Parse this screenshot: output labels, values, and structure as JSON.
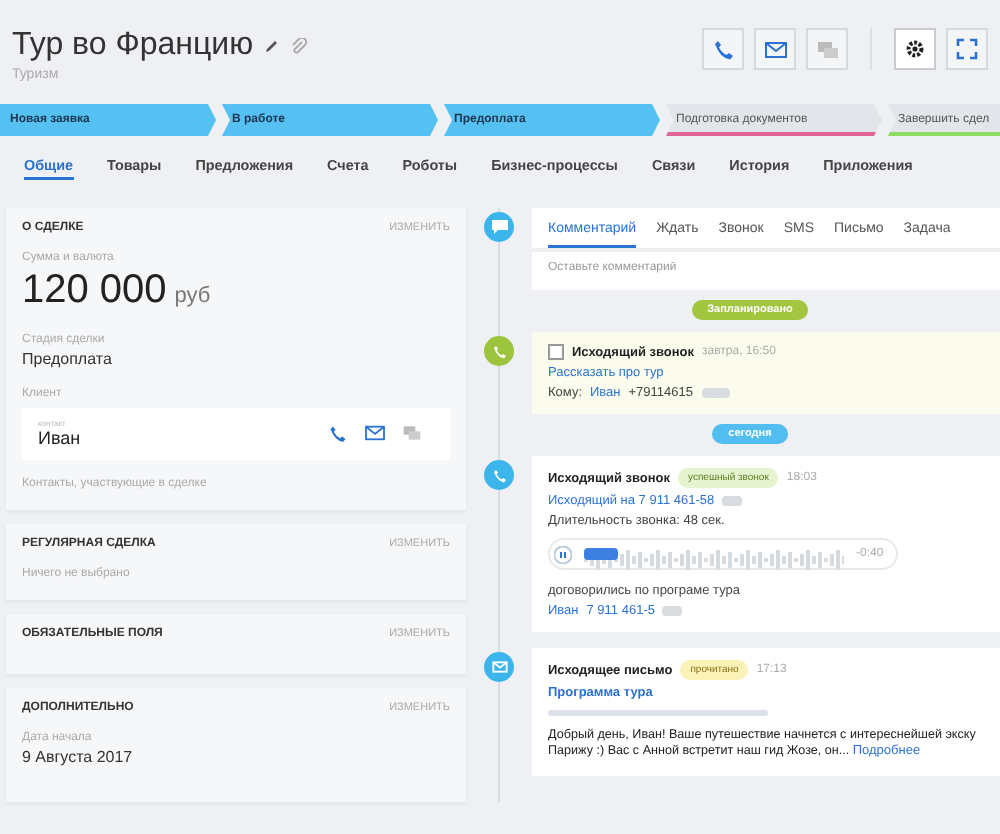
{
  "header": {
    "title": "Тур во Францию",
    "subtitle": "Туризм"
  },
  "stages": [
    {
      "label": "Новая заявка",
      "done": true,
      "color": "#55c0f2"
    },
    {
      "label": "В работе",
      "done": true,
      "color": "#55c0f2"
    },
    {
      "label": "Предоплата",
      "done": true,
      "color": "#55c0f2"
    },
    {
      "label": "Подготовка документов",
      "done": false,
      "color": "#e0669a"
    },
    {
      "label": "Завершить сдел",
      "done": false,
      "color": "#8fdb64"
    }
  ],
  "tabs": [
    {
      "label": "Общие",
      "selected": true
    },
    {
      "label": "Товары",
      "selected": false
    },
    {
      "label": "Предложения",
      "selected": false
    },
    {
      "label": "Счета",
      "selected": false
    },
    {
      "label": "Роботы",
      "selected": false
    },
    {
      "label": "Бизнес-процессы",
      "selected": false
    },
    {
      "label": "Связи",
      "selected": false
    },
    {
      "label": "История",
      "selected": false
    },
    {
      "label": "Приложения",
      "selected": false
    }
  ],
  "deal": {
    "title": "О СДЕЛКЕ",
    "edit": "ИЗМЕНИТЬ",
    "amount_label": "Сумма и валюта",
    "amount": "120 000",
    "currency": "руб",
    "stage_label": "Стадия сделки",
    "stage": "Предоплата",
    "client_label": "Клиент",
    "contact_label": "контакт",
    "contact": "Иван",
    "participants": "Контакты, участвующие в сделке"
  },
  "sections": [
    {
      "title": "РЕГУЛЯРНАЯ СДЕЛКА",
      "edit": "ИЗМЕНИТЬ",
      "note": "Ничего не выбрано"
    },
    {
      "title": "ОБЯЗАТЕЛЬНЫЕ ПОЛЯ",
      "edit": "ИЗМЕНИТЬ"
    },
    {
      "title": "ДОПОЛНИТЕЛЬНО",
      "edit": "ИЗМЕНИТЬ",
      "field_label": "Дата начала",
      "field_value": "9 Августа 2017"
    }
  ],
  "composer": {
    "tabs": [
      {
        "label": "Комментарий",
        "selected": true
      },
      {
        "label": "Ждать",
        "selected": false
      },
      {
        "label": "Звонок",
        "selected": false
      },
      {
        "label": "SMS",
        "selected": false
      },
      {
        "label": "Письмо",
        "selected": false
      },
      {
        "label": "Задача",
        "selected": false
      }
    ],
    "placeholder": "Оставьте комментарий"
  },
  "planned_badge": "Запланировано",
  "planned_call": {
    "checked": false,
    "title": "Исходящий звонок",
    "time": "завтра, 16:50",
    "subject": "Рассказать про тур",
    "to_label": "Кому:",
    "to_name": "Иван",
    "to_phone": "+79114615"
  },
  "today_badge": "сегодня",
  "call": {
    "title": "Исходящий звонок",
    "status": "успешный звонок",
    "time": "18:03",
    "link": "Исходящий на 7 911 461-58",
    "duration": "Длительность звонка: 48 сек.",
    "player": {
      "level": 0.13,
      "remaining": "-0:40"
    },
    "note": "договорились по програме тура",
    "contact_name": "Иван",
    "contact_phone": "7 911 461-5"
  },
  "email": {
    "title": "Исходящее письмо",
    "status": "прочитано",
    "time": "17:13",
    "subject": "Программа тура",
    "body": "Добрый день, Иван!  Ваше путешествие начнется с интереснейшей экску Парижу :) Вас с Анной встретит наш гид Жозе, он...",
    "more": "Подробнее"
  }
}
